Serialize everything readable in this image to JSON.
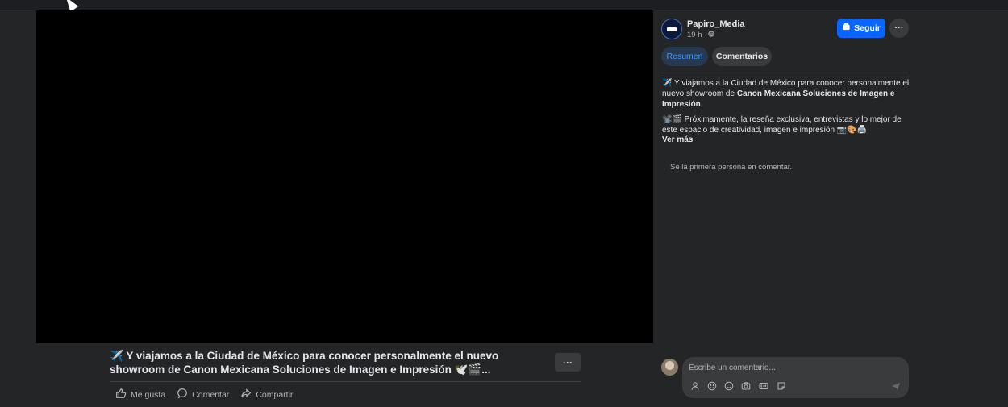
{
  "post": {
    "title_line1": "✈️ Y viajamos a la Ciudad de México para conocer personalmente el nuevo",
    "title_line2": "showroom de Canon Mexicana Soluciones de Imagen e Impresión 🕊️🎬...",
    "more_label": "···",
    "actions": {
      "like": "Me gusta",
      "comment": "Comentar",
      "share": "Compartir"
    }
  },
  "panel": {
    "page_name": "Papiro_Media",
    "time": "19 h ·",
    "follow_label": "Seguir",
    "more_label": "···",
    "tabs": {
      "summary": "Resumen",
      "comments": "Comentarios"
    },
    "caption": {
      "p1_prefix": "✈️ Y viajamos a la Ciudad de México para conocer personalmente el nuevo showroom de ",
      "p1_bold": "Canon Mexicana Soluciones de Imagen e Impresión",
      "p2": "📽️🎬 Próximamente, la reseña exclusiva, entrevistas y lo mejor de este espacio de creatividad, imagen e impresión 📷🎨🖨️",
      "see_more": "Ver más"
    },
    "first_comment_text": "Sé la primera persona en comentar.",
    "comment_placeholder": "Escribe un comentario..."
  },
  "icons": [
    "like-icon",
    "comment-icon",
    "share-icon",
    "follow-icon",
    "globe-icon",
    "avatar-sticker-icon",
    "emoji-icon",
    "camera-icon",
    "gif-icon",
    "sticker-icon",
    "send-icon"
  ],
  "colors": {
    "background": "#242526",
    "video": "#000000",
    "accent": "#0866ff",
    "tab_active_bg": "#263951",
    "tab_active_text": "#4599ff",
    "muted_text": "#b0b3b8"
  }
}
